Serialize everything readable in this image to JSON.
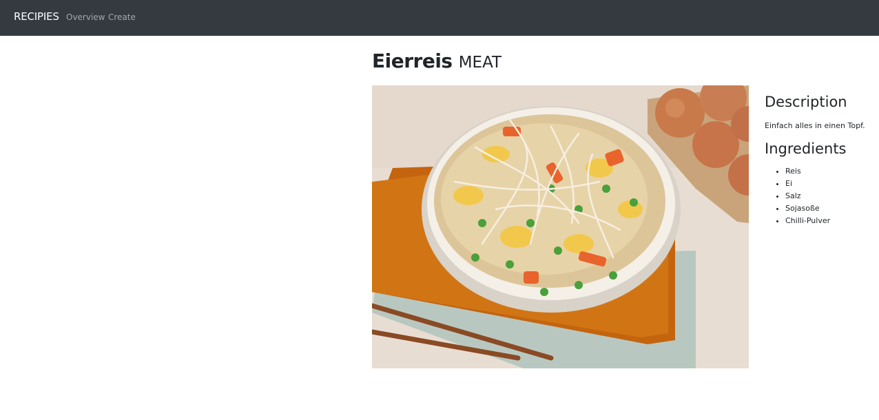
{
  "navbar": {
    "brand": "RECIPIES",
    "links": [
      "Overview",
      "Create"
    ],
    "background": "#343a40"
  },
  "recipe": {
    "title": "Eierreis",
    "category": "MEAT",
    "image_icon": "fried-rice-photo",
    "description_heading": "Description",
    "description": "Einfach alles in einen Topf.",
    "ingredients_heading": "Ingredients",
    "ingredients": [
      "Reis",
      "Ei",
      "Salz",
      "Sojasoße",
      "Chilli-Pulver"
    ]
  }
}
